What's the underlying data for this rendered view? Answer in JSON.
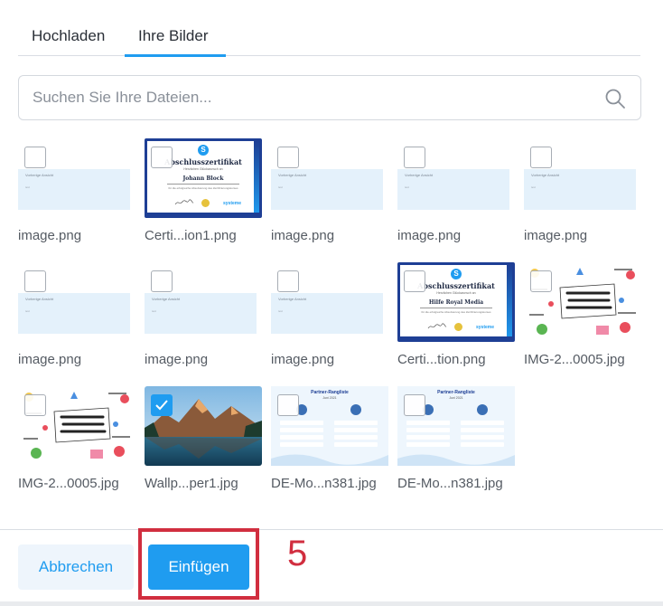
{
  "tabs": [
    {
      "label": "Hochladen",
      "active": false
    },
    {
      "label": "Ihre Bilder",
      "active": true
    }
  ],
  "search": {
    "placeholder": "Suchen Sie Ihre Dateien..."
  },
  "images": [
    {
      "name": "image.png",
      "kind": "blank",
      "checked": false
    },
    {
      "name": "Certi...ion1.png",
      "kind": "certificate",
      "checked": false
    },
    {
      "name": "image.png",
      "kind": "blank",
      "checked": false
    },
    {
      "name": "image.png",
      "kind": "blank",
      "checked": false
    },
    {
      "name": "image.png",
      "kind": "blank",
      "checked": false
    },
    {
      "name": "image.png",
      "kind": "blank",
      "checked": false
    },
    {
      "name": "image.png",
      "kind": "blank",
      "checked": false
    },
    {
      "name": "image.png",
      "kind": "blank",
      "checked": false
    },
    {
      "name": "Certi...tion.png",
      "kind": "certificate",
      "checked": false
    },
    {
      "name": "IMG-2...0005.jpg",
      "kind": "birthday",
      "checked": false
    },
    {
      "name": "IMG-2...0005.jpg",
      "kind": "birthday",
      "checked": false
    },
    {
      "name": "Wallp...per1.jpg",
      "kind": "wallpaper",
      "checked": true
    },
    {
      "name": "DE-Mo...n381.jpg",
      "kind": "ranking",
      "checked": false
    },
    {
      "name": "DE-Mo...n381.jpg",
      "kind": "ranking",
      "checked": false
    }
  ],
  "blank_thumb": {
    "line1": "Vorherige Ansicht",
    "line2": "text"
  },
  "certificates": {
    "logo": "S",
    "title": "Abschlusszertifikat",
    "subtitle": "Herzlichen Glückwunsch an",
    "names": [
      "Johann Block",
      "Hilfe Royal Media"
    ],
    "description": "für die erfolgreiche Absolvierung des Zertifizierungskurses",
    "brand": "systeme"
  },
  "ranking": {
    "title": "Partner-Rangliste",
    "subtitle": "Juni 2021"
  },
  "footer": {
    "cancel_label": "Abbrechen",
    "insert_label": "Einfügen",
    "step_number": "5"
  },
  "colors": {
    "accent": "#1f9cf0",
    "highlight": "#d12e3f",
    "cert_border": "#1e3f95"
  }
}
